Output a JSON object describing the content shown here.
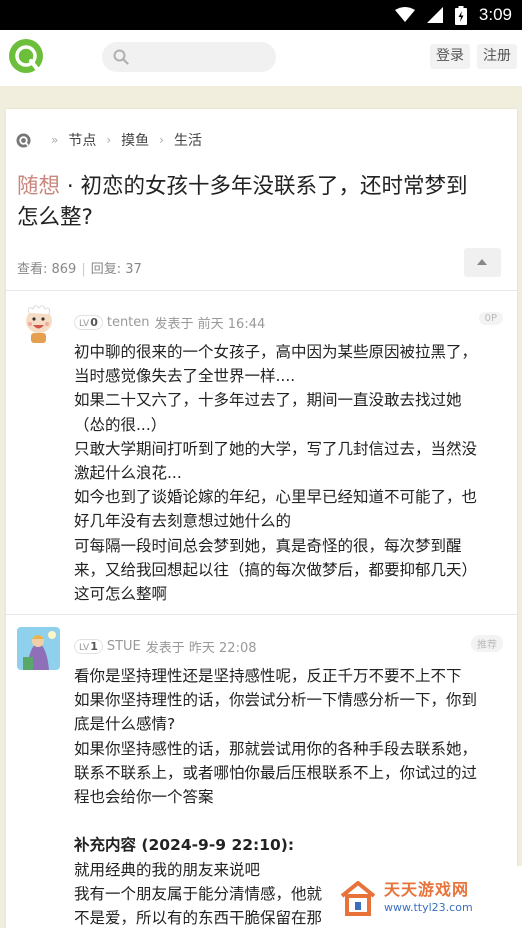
{
  "status_bar": {
    "time": "3:09"
  },
  "header": {
    "login_label": "登录",
    "register_label": "注册"
  },
  "breadcrumb": {
    "items": [
      "节点",
      "摸鱼",
      "生活"
    ]
  },
  "thread": {
    "tag": "随想",
    "separator": "·",
    "title_lines": [
      "初恋的女孩十多年没联系了，还时常梦到",
      "怎么整?"
    ],
    "views_label": "查看: 869",
    "replies_label": "回复: 37"
  },
  "posts": [
    {
      "level_prefix": "LV",
      "level": "0",
      "author": "tenten",
      "time": "发表于 前天 16:44",
      "badge": "0P",
      "lines": [
        "初中聊的很来的一个女孩子，高中因为某些原因被拉黑了，",
        "当时感觉像失去了全世界一样....",
        "如果二十又六了，十多年过去了，期间一直没敢去找过她",
        "（怂的很...）",
        "只敢大学期间打听到了她的大学，写了几封信过去，当然没",
        "激起什么浪花...",
        "如今也到了谈婚论嫁的年纪，心里早已经知道不可能了，也",
        "好几年没有去刻意想过她什么的",
        "可每隔一段时间总会梦到她，真是奇怪的很，每次梦到醒",
        "来，又给我回想起以往（搞的每次做梦后，都要抑郁几天）",
        "这可怎么整啊"
      ]
    },
    {
      "level_prefix": "LV",
      "level": "1",
      "author": "STUE",
      "time": "发表于 昨天 22:08",
      "badge": "推荐",
      "lines": [
        "看你是坚持理性还是坚持感性呢，反正千万不要不上不下",
        "如果你坚持理性的话，你尝试分析一下情感分析一下，你到",
        "底是什么感情?",
        "如果你坚持感性的话，那就尝试用你的各种手段去联系她，",
        "联系不联系上，或者哪怕你最后压根联系不上，你试过的过",
        "程也会给你一个答案",
        "",
        "补充内容 (2024-9-9 22:10):",
        "就用经典的我的朋友来说吧",
        "我有一个朋友属于能分清情感，他就",
        "不是爱，所以有的东西干脆保留在那"
      ]
    }
  ],
  "watermark": {
    "name": "天天游戏网",
    "url": "www.ttyl23.com"
  },
  "colors": {
    "accent_green": "#6cbf3a",
    "tag_color": "#c9867d",
    "watermark_orange": "#e8733a"
  }
}
